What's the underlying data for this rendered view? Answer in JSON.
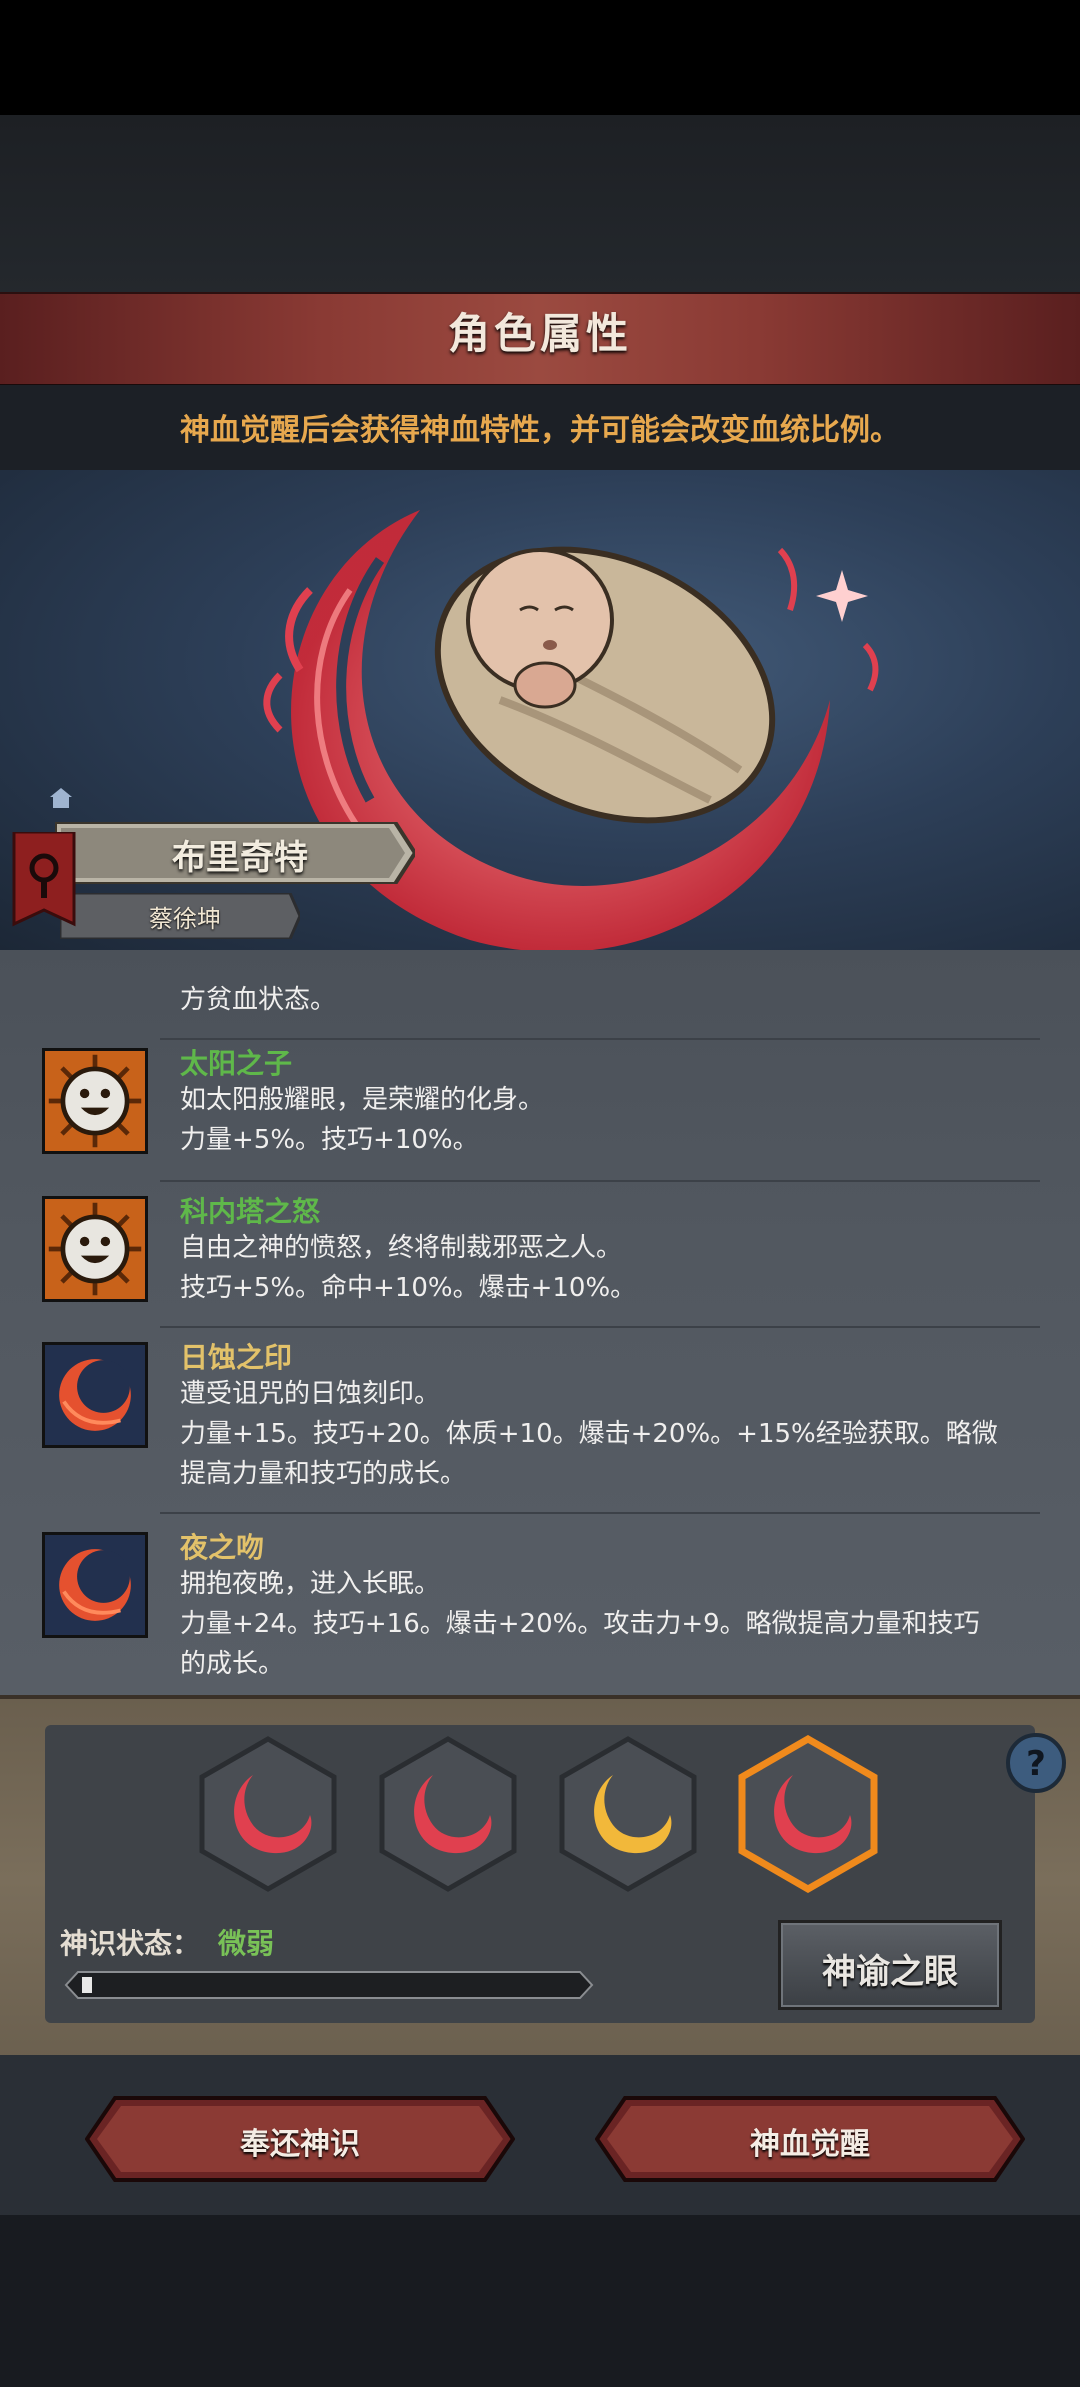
{
  "header": {
    "title": "角色属性",
    "subtitle": "神血觉醒后会获得神血特性，并可能会改变血统比例。"
  },
  "character": {
    "name": "布里奇特",
    "subname": "蔡徐坤"
  },
  "traits": {
    "partial_text": "方贫血状态。",
    "items": [
      {
        "title": "太阳之子",
        "title_color": "#5fb84a",
        "icon": "sun-face-icon",
        "desc": "如太阳般耀眼，是荣耀的化身。",
        "effect": "力量+5%。技巧+10%。"
      },
      {
        "title": "科内塔之怒",
        "title_color": "#5fb84a",
        "icon": "sun-face-icon",
        "desc": "自由之神的愤怒，终将制裁邪恶之人。",
        "effect": "技巧+5%。命中+10%。爆击+10%。"
      },
      {
        "title": "日蚀之印",
        "title_color": "#e3c26a",
        "icon": "eclipse-swirl-icon",
        "desc": "遭受诅咒的日蚀刻印。",
        "effect": "力量+15。技巧+20。体质+10。爆击+20%。+15%经验获取。略微",
        "effect2": "提高力量和技巧的成长。"
      },
      {
        "title": "夜之吻",
        "title_color": "#e3c26a",
        "icon": "eclipse-swirl-icon",
        "desc": "拥抱夜晚，进入长眠。",
        "effect": "力量+24。技巧+16。爆击+20%。攻击力+9。略微提高力量和技巧",
        "effect2": "的成长。"
      }
    ]
  },
  "divine": {
    "slots": [
      {
        "color": "red"
      },
      {
        "color": "red"
      },
      {
        "color": "gold"
      },
      {
        "color": "red",
        "selected": true
      }
    ],
    "state_label": "神识状态：",
    "state_value": "微弱",
    "progress": 0.02,
    "oracle_button": "神谕之眼",
    "help_icon": "question-icon"
  },
  "actions": {
    "return_button": "奉还神识",
    "awaken_button": "神血觉醒"
  }
}
